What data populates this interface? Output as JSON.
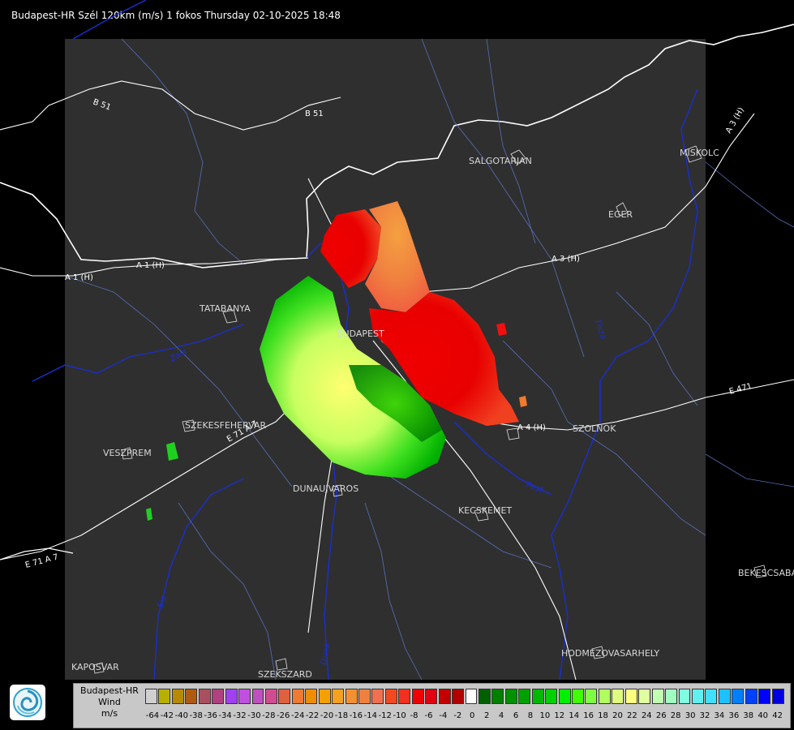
{
  "title": "Budapest-HR Szél 120km (m/s) 1 fokos Thursday 02-10-2025 18:48",
  "cities": [
    "SALGOTARJAN",
    "EGER",
    "MISKOLC",
    "TATABANYA",
    "BUDAPEST",
    "SZEKESFEHERVAR",
    "VESZPREM",
    "DUNAUJVAROS",
    "KECSKEMET",
    "SZOLNOK",
    "BEKESCSABA",
    "KAPOSVAR",
    "SZEKSZARD",
    "HODMEZOVASARHELY"
  ],
  "roads": [
    "B 51",
    "B 51",
    "A 3 (H)",
    "A 3 (H)",
    "A 4 (H)",
    "E 471",
    "A 1 (H)",
    "A 1 (H)",
    "E 71 A 7",
    "E 71 A 7"
  ],
  "rivers": [
    "Duna",
    "Zala",
    "Sio",
    "Tisza",
    "Pest"
  ],
  "legend": {
    "station": "Budapest-HR",
    "quantity": "Wind",
    "unit": "m/s",
    "colors": [
      "#d0d0d0",
      "#b8b000",
      "#b88a00",
      "#b05a10",
      "#a85060",
      "#b04080",
      "#a040f0",
      "#c050e0",
      "#c050c0",
      "#d04c90",
      "#e06040",
      "#f07a30",
      "#f08c00",
      "#f4a000",
      "#f4a020",
      "#f49030",
      "#f08040",
      "#f07050",
      "#f04a20",
      "#f03020",
      "#f00000",
      "#e00010",
      "#c00000",
      "#b00000",
      "#ffffff",
      "#006000",
      "#008000",
      "#009000",
      "#00a000",
      "#00b800",
      "#00d000",
      "#00ee00",
      "#40ff00",
      "#80ff40",
      "#b0ff60",
      "#e0ff80",
      "#ffff80",
      "#e0ffa0",
      "#c0ffb0",
      "#a0ffc0",
      "#80ffe0",
      "#60f0f0",
      "#40e0ff",
      "#20c0ff",
      "#0080ff",
      "#0040ff",
      "#0000ff",
      "#0000e0"
    ],
    "labels": [
      "-64",
      "-42",
      "-40",
      "-38",
      "-36",
      "-34",
      "-32",
      "-30",
      "-28",
      "-26",
      "-24",
      "-22",
      "-20",
      "-18",
      "-16",
      "-14",
      "-12",
      "-10",
      "-8",
      "-6",
      "-4",
      "-2",
      "0",
      "2",
      "4",
      "6",
      "8",
      "10",
      "12",
      "14",
      "16",
      "18",
      "20",
      "22",
      "24",
      "26",
      "28",
      "30",
      "32",
      "34",
      "36",
      "38",
      "40",
      "42"
    ]
  }
}
